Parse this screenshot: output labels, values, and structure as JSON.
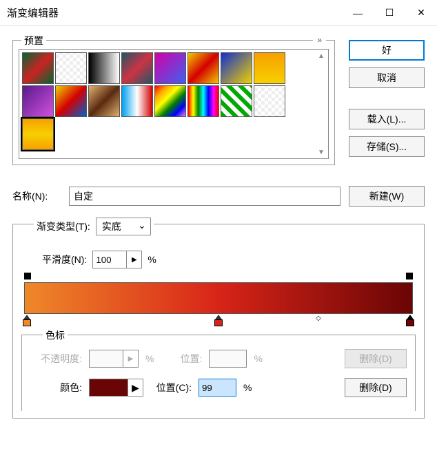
{
  "titlebar": {
    "title": "渐变编辑器",
    "minimize": "—",
    "maximize": "☐",
    "close": "✕"
  },
  "presets": {
    "label": "预置",
    "expand": "»"
  },
  "buttons": {
    "ok": "好",
    "cancel": "取消",
    "load": "载入(L)...",
    "save": "存储(S)...",
    "new": "新建(W)",
    "delete_opacity": "删除(D)",
    "delete_color": "删除(D)"
  },
  "name": {
    "label": "名称(N):",
    "value": "自定"
  },
  "gradient": {
    "type_label": "渐变类型(T):",
    "type_value": "实底",
    "smooth_label": "平滑度(N):",
    "smooth_value": "100",
    "percent": "%"
  },
  "stops": {
    "label": "色标",
    "opacity_label": "不透明度:",
    "opacity_value": "",
    "opacity_pos_label": "位置:",
    "opacity_pos_value": "",
    "color_label": "颜色:",
    "color_value": "#6a0505",
    "color_pos_label": "位置(C):",
    "color_pos_value": "99"
  },
  "chart_data": {
    "type": "gradient",
    "opacity_stops": [
      {
        "position": 0,
        "opacity": 100
      },
      {
        "position": 100,
        "opacity": 100
      }
    ],
    "color_stops": [
      {
        "position": 0,
        "color": "#ef8829"
      },
      {
        "position": 50,
        "color": "#d82418"
      },
      {
        "position": 99,
        "color": "#6a0505"
      }
    ],
    "midpoints": [
      75
    ]
  }
}
